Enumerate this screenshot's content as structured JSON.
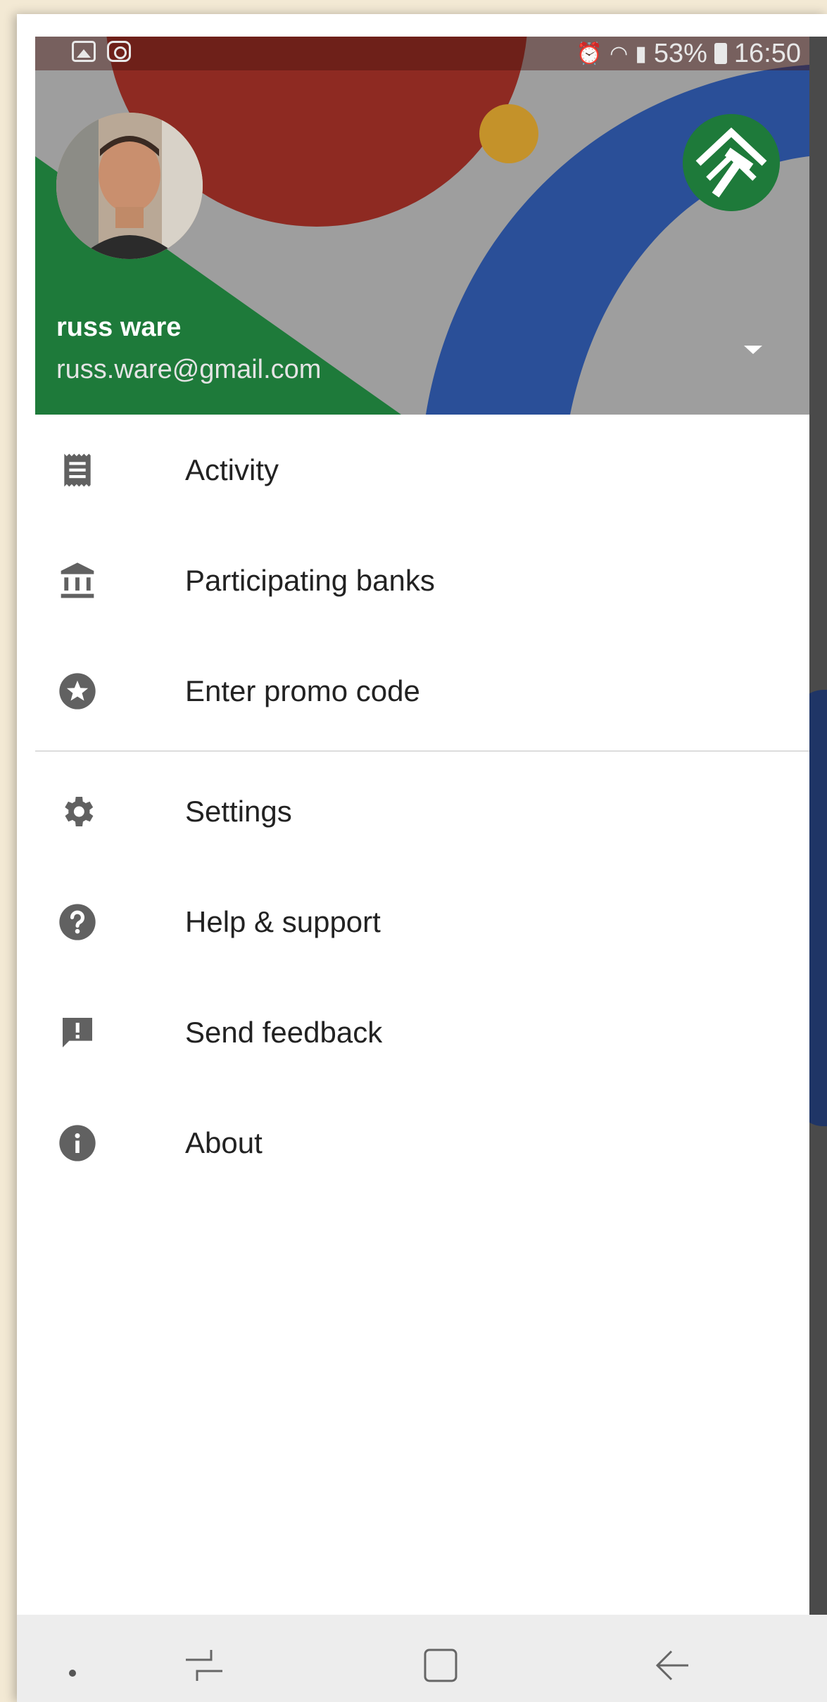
{
  "status_bar": {
    "battery_percent": "53%",
    "time": "16:50"
  },
  "account": {
    "name": "russ ware",
    "email": "russ.ware@gmail.com"
  },
  "menu_primary": [
    {
      "label": "Activity",
      "icon": "receipt-icon"
    },
    {
      "label": "Participating banks",
      "icon": "bank-icon"
    },
    {
      "label": "Enter promo code",
      "icon": "star-circle-icon"
    }
  ],
  "menu_secondary": [
    {
      "label": "Settings",
      "icon": "gear-icon"
    },
    {
      "label": "Help & support",
      "icon": "help-icon"
    },
    {
      "label": "Send feedback",
      "icon": "feedback-icon"
    },
    {
      "label": "About",
      "icon": "info-icon"
    }
  ],
  "colors": {
    "header_red": "#8e2a22",
    "header_blue": "#2a4f98",
    "header_green": "#1e7a3a",
    "header_gray": "#9e9e9e",
    "accent_gold": "#c4922a",
    "icon_gray": "#616161"
  }
}
